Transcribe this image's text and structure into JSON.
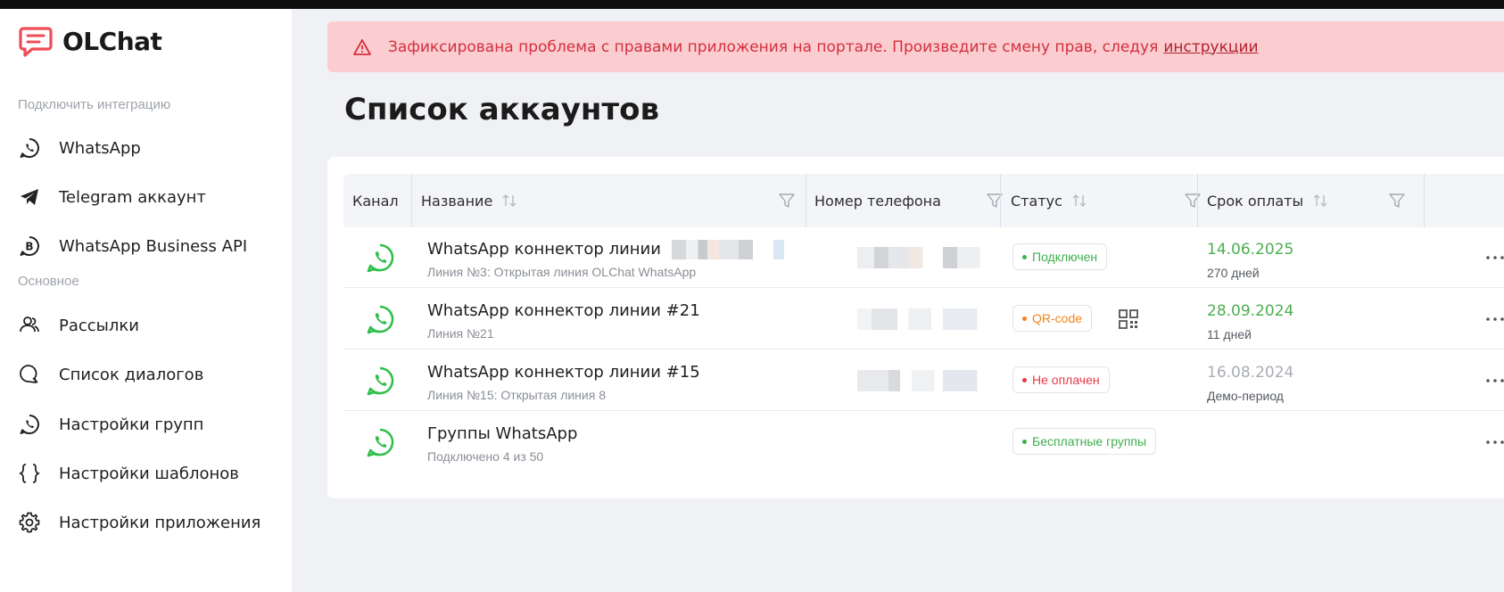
{
  "app": {
    "name": "OLChat"
  },
  "sidebar": {
    "section_integration": "Подключить интеграцию",
    "section_main": "Основное",
    "integration_items": [
      {
        "label": "WhatsApp",
        "icon": "whatsapp-icon"
      },
      {
        "label": "Telegram аккаунт",
        "icon": "telegram-icon"
      },
      {
        "label": "WhatsApp Business API",
        "icon": "whatsapp-business-icon"
      }
    ],
    "main_items": [
      {
        "label": "Рассылки",
        "icon": "users-icon"
      },
      {
        "label": "Список диалогов",
        "icon": "chat-search-icon"
      },
      {
        "label": "Настройки групп",
        "icon": "whatsapp-icon"
      },
      {
        "label": "Настройки шаблонов",
        "icon": "braces-icon"
      },
      {
        "label": "Настройки приложения",
        "icon": "gear-icon"
      }
    ]
  },
  "alert": {
    "text": "Зафиксирована проблема с правами приложения на портале. Произведите смену прав, следуя",
    "link": "инструкции",
    "icon": "warning-icon"
  },
  "page_title": "Список аккаунтов",
  "table": {
    "columns": [
      "Канал",
      "Название",
      "Номер телефона",
      "Статус",
      "Срок оплаты"
    ],
    "rows": [
      {
        "title": "WhatsApp коннектор линии",
        "subtitle": "Линия №3: Открытая линия OLChat WhatsApp",
        "status": "Подключен",
        "status_color": "#3fae4f",
        "date": "14.06.2025",
        "date_color": "#4caf50",
        "date_sub": "270 дней"
      },
      {
        "title": "WhatsApp коннектор линии #21",
        "subtitle": "Линия №21",
        "status": "QR-code",
        "status_color": "#f0841d",
        "date": "28.09.2024",
        "date_color": "#4caf50",
        "date_sub": "11 дней"
      },
      {
        "title": "WhatsApp коннектор линии #15",
        "subtitle": "Линия №15: Открытая линия 8",
        "status": "Не оплачен",
        "status_color": "#e53945",
        "date": "16.08.2024",
        "date_color": "#a9adb3",
        "date_sub": "Демо-период"
      },
      {
        "title": "Группы WhatsApp",
        "subtitle": "Подключено 4 из 50",
        "status": "Бесплатные группы",
        "status_color": "#3fae4f"
      }
    ]
  },
  "colors": {
    "whatsapp_green": "#2fbf4a",
    "brand_red": "#ef4b57",
    "alert_bg": "#fbcdd0"
  }
}
